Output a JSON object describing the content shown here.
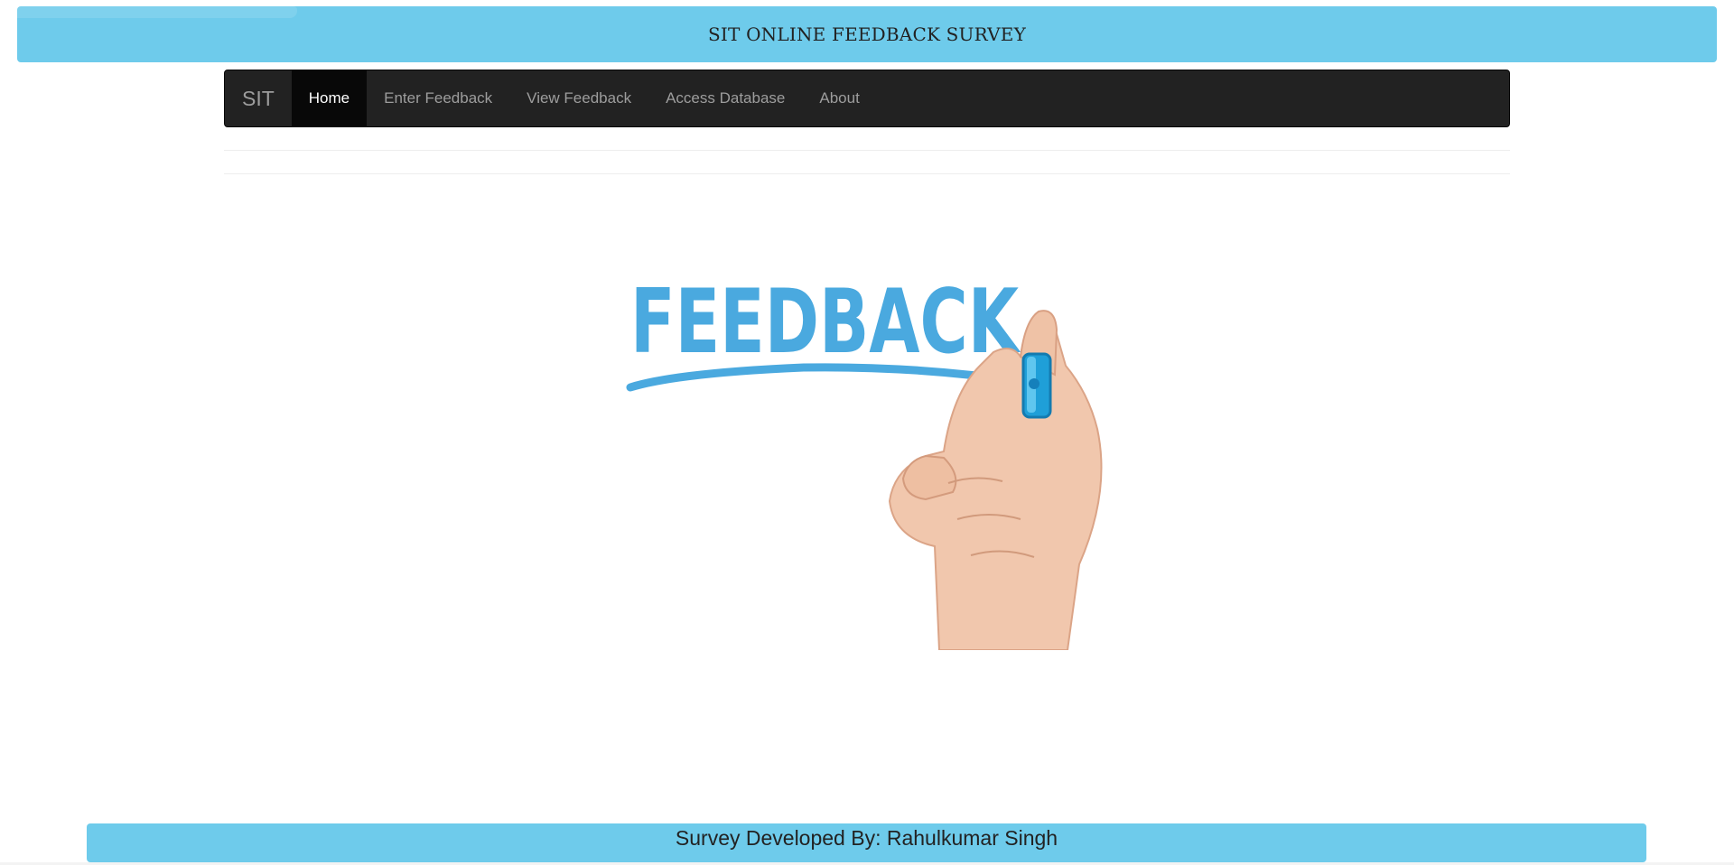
{
  "header": {
    "title": "SIT ONLINE FEEDBACK SURVEY"
  },
  "navbar": {
    "brand": "SIT",
    "items": [
      {
        "label": "Home",
        "active": true
      },
      {
        "label": "Enter Feedback",
        "active": false
      },
      {
        "label": "View Feedback",
        "active": false
      },
      {
        "label": "Access Database",
        "active": false
      },
      {
        "label": "About",
        "active": false
      }
    ]
  },
  "hero": {
    "word": "FEEDBACK",
    "icon": "hand-with-marker-illustration"
  },
  "footer": {
    "text": "Survey Developed By: Rahulkumar Singh"
  },
  "colors": {
    "banner": "#6ecbeb",
    "navbar": "#222222",
    "active_nav": "#080808",
    "feedback_blue": "#4aa9df"
  }
}
